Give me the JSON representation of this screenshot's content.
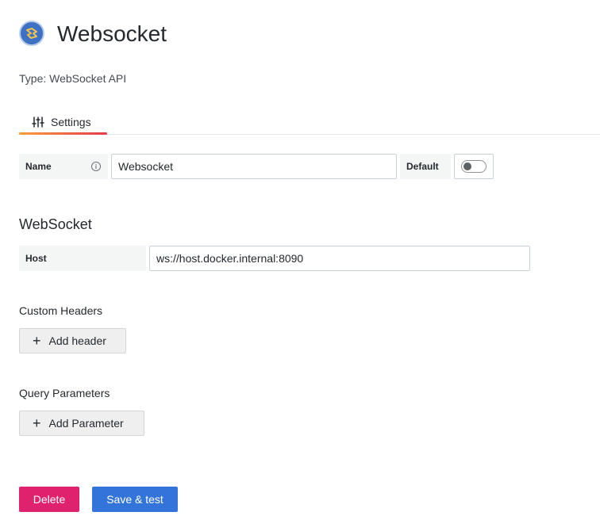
{
  "header": {
    "title": "Websocket",
    "subtitle": "Type: WebSocket API",
    "logo_icon": "websocket-plugin-logo"
  },
  "tabs": [
    {
      "label": "Settings",
      "icon": "sliders-icon",
      "active": true
    }
  ],
  "settings": {
    "name_label": "Name",
    "name_value": "Websocket",
    "default_label": "Default",
    "default_enabled": false
  },
  "websocket": {
    "section_title": "WebSocket",
    "host_label": "Host",
    "host_value": "ws://host.docker.internal:8090"
  },
  "custom_headers": {
    "title": "Custom Headers",
    "add_label": "Add header"
  },
  "query_parameters": {
    "title": "Query Parameters",
    "add_label": "Add Parameter"
  },
  "actions": {
    "delete_label": "Delete",
    "save_label": "Save & test"
  },
  "colors": {
    "delete": "#e0226e",
    "save": "#3274d9",
    "tab_gradient_start": "#f99e3b",
    "tab_gradient_end": "#e8384c"
  }
}
